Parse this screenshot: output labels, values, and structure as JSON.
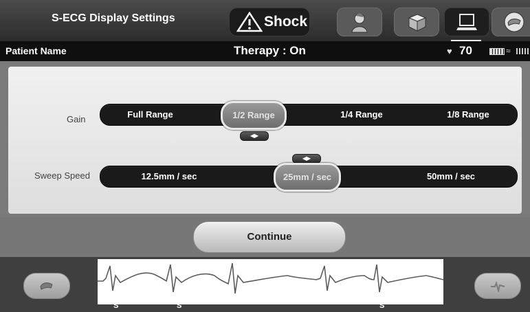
{
  "header": {
    "title": "S-ECG Display Settings",
    "shock_label": "Shock",
    "icons": [
      "patient-icon",
      "package-icon",
      "laptop-icon",
      "hand-icon"
    ]
  },
  "status": {
    "patient_name_label": "Patient Name",
    "therapy": "Therapy : On",
    "heart_rate": "70"
  },
  "settings": {
    "gain": {
      "label": "Gain",
      "options": [
        "Full Range",
        "1/2 Range",
        "1/4 Range",
        "1/8 Range"
      ],
      "selected": "1/2 Range"
    },
    "sweep": {
      "label": "Sweep Speed",
      "options": [
        "12.5mm / sec",
        "25mm / sec",
        "50mm / sec"
      ],
      "selected": "25mm / sec"
    }
  },
  "continue_label": "Continue",
  "ecg": {
    "markers": [
      "S",
      "S",
      "S"
    ]
  },
  "colors": {
    "header": "#2b2b2b",
    "status_bar": "#0f0f0f",
    "panel": "#e5e5e5",
    "track": "#1a1a1a",
    "selected_option": "#8a8a8a"
  }
}
